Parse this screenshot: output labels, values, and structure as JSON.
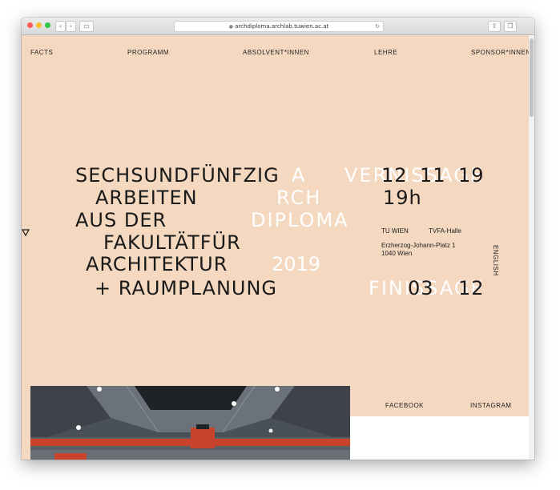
{
  "browser": {
    "url": "archdiploma.archlab.tuwien.ac.at"
  },
  "nav": {
    "facts": "FACTS",
    "programm": "PROGRAMM",
    "absolventinnen": "ABSOLVENT*INNEN",
    "lehre": "LEHRE",
    "sponsorinnen": "SPONSOR*INNEN"
  },
  "hero": {
    "lines": [
      "SECHSUNDFÜNFZIG",
      "ARBEITEN",
      "AUS DER",
      "FAKULTÄTFÜR",
      "ARCHITEKTUR",
      "+ RAUMPLANUNG"
    ],
    "ghost": {
      "a": "A",
      "rch": "RCH",
      "diploma": "DIPLOMA",
      "year": "2019",
      "vernissage": "VERNISSAGE",
      "finissage": "FINISSAGE"
    },
    "date_day": "12",
    "date_month": "11",
    "date_year": "19",
    "time": "19h",
    "finissage_day": "03",
    "finissage_month": "12"
  },
  "venue": {
    "org": "TU WIEN",
    "hall": "TVFA-Halle",
    "street": "Erzherzog-Johann-Platz 1",
    "city": "1040 Wien"
  },
  "language": "ENGLISH",
  "social": {
    "facebook": "FACEBOOK",
    "instagram": "INSTAGRAM"
  },
  "colors": {
    "background": "#f4d8c0",
    "text": "#1a1a1a",
    "ghost": "#ffffff"
  }
}
